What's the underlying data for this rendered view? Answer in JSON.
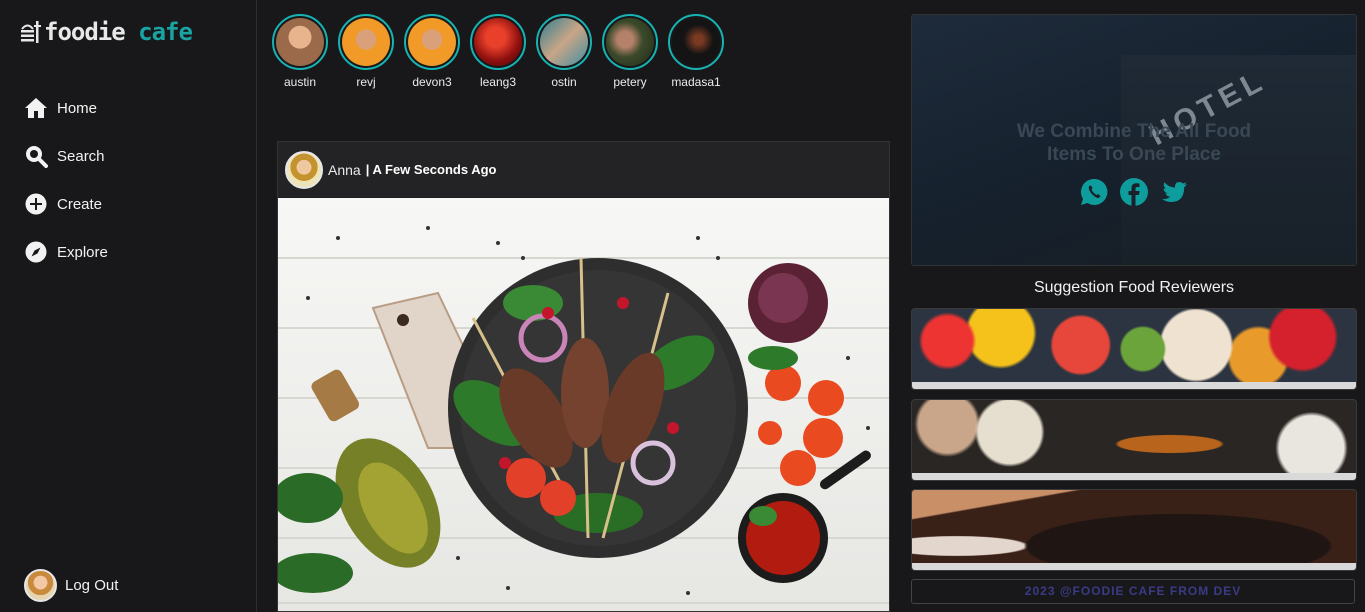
{
  "app": {
    "logo_part1": "foodie",
    "logo_part2": "cafe"
  },
  "nav": {
    "items": [
      {
        "label": "Home",
        "icon": "home-icon"
      },
      {
        "label": "Search",
        "icon": "search-icon"
      },
      {
        "label": "Create",
        "icon": "plus-circle-icon"
      },
      {
        "label": "Explore",
        "icon": "compass-icon"
      }
    ],
    "logout_label": "Log Out"
  },
  "stories": [
    {
      "name": "austin",
      "color": "#b4825e"
    },
    {
      "name": "revj",
      "color": "#f19a27"
    },
    {
      "name": "devon3",
      "color": "#f19a27"
    },
    {
      "name": "leang3",
      "color": "#c81b1b"
    },
    {
      "name": "ostin",
      "color": "#3f8ea0"
    },
    {
      "name": "petery",
      "color": "#3c4a2b"
    },
    {
      "name": "madasa1",
      "color": "#141414"
    }
  ],
  "post": {
    "user": "Anna",
    "separator": " | ",
    "time": "A Few Seconds Ago"
  },
  "banner": {
    "line1": "We Combine The All Food",
    "line2": "Items To One Place",
    "sign_text": "HOTEL",
    "social_color": "#0f9c9c"
  },
  "suggestions": {
    "title": "Suggestion Food Reviewers"
  },
  "footer": {
    "text": "2023 @FOODIE CAFE FROM DEV"
  }
}
